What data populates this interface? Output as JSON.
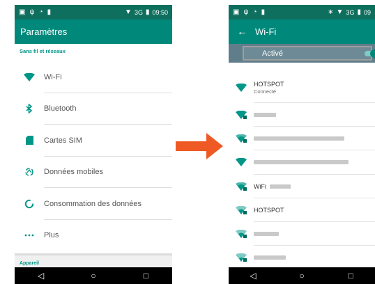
{
  "colors": {
    "status_bar": "#0e6f5f",
    "app_bar": "#00897b",
    "accent": "#009688",
    "toggle_row": "#607d8b",
    "arrow": "#ef5a24"
  },
  "left_screen": {
    "status_bar": {
      "network": "3G",
      "time": "09:50"
    },
    "app_bar": {
      "title": "Paramètres"
    },
    "section_header": "Sans fil et réseaux",
    "items": [
      {
        "label": "Wi-Fi",
        "icon": "wifi-icon"
      },
      {
        "label": "Bluetooth",
        "icon": "bluetooth-icon"
      },
      {
        "label": "Cartes SIM",
        "icon": "sim-card-icon"
      },
      {
        "label": "Données mobiles",
        "icon": "mobile-data-icon"
      },
      {
        "label": "Consommation des données",
        "icon": "data-usage-icon"
      },
      {
        "label": "Plus",
        "icon": "more-icon"
      }
    ],
    "bottom_label": "Appareil"
  },
  "right_screen": {
    "status_bar": {
      "network": "3G",
      "time": "09"
    },
    "app_bar": {
      "title": "Wi-Fi",
      "back_icon": "back-arrow-icon"
    },
    "toggle": {
      "label": "Activé",
      "state": "on"
    },
    "networks": [
      {
        "name": "HOTSPOT",
        "status": "Connecté",
        "secured": false
      },
      {
        "name": "",
        "secured": true
      },
      {
        "name": "",
        "secured": true
      },
      {
        "name": "",
        "secured": false
      },
      {
        "name": "WiFi",
        "secured": true
      },
      {
        "name": "HOTSPOT",
        "secured": true
      },
      {
        "name": "",
        "secured": true
      },
      {
        "name": "",
        "secured": true
      }
    ]
  },
  "navigation": {
    "back": "◁",
    "home": "○",
    "recents": "□"
  }
}
